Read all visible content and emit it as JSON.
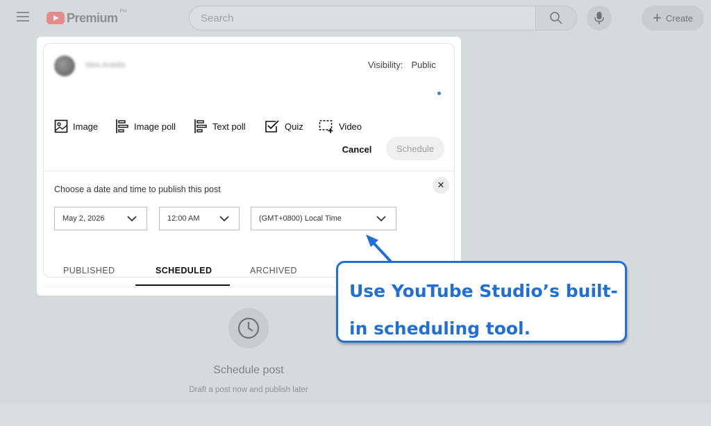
{
  "topbar": {
    "logo_text": "Premium",
    "logo_sup": "PH",
    "search_placeholder": "Search",
    "create_label": "Create"
  },
  "post": {
    "author_name": "Wes Antello",
    "visibility_label": "Visibility:",
    "visibility_value": "Public",
    "attachments": [
      "Image",
      "Image poll",
      "Text poll",
      "Quiz",
      "Video"
    ],
    "cancel_label": "Cancel",
    "schedule_label": "Schedule"
  },
  "schedule": {
    "heading": "Choose a date and time to publish this post",
    "date": "May 2, 2026",
    "time": "12:00 AM",
    "timezone": "(GMT+0800) Local Time"
  },
  "tabs": [
    "PUBLISHED",
    "SCHEDULED",
    "ARCHIVED"
  ],
  "active_tab": "SCHEDULED",
  "empty_state": {
    "title": "Schedule post",
    "subtitle": "Draft a post now and publish later"
  },
  "callout": {
    "text": "Use YouTube Studio’s built-in scheduling tool."
  },
  "colors": {
    "callout_blue": "#1f6fd6",
    "overlay_gray": "#d5dada",
    "accent_dot": "#3e7fd8"
  }
}
